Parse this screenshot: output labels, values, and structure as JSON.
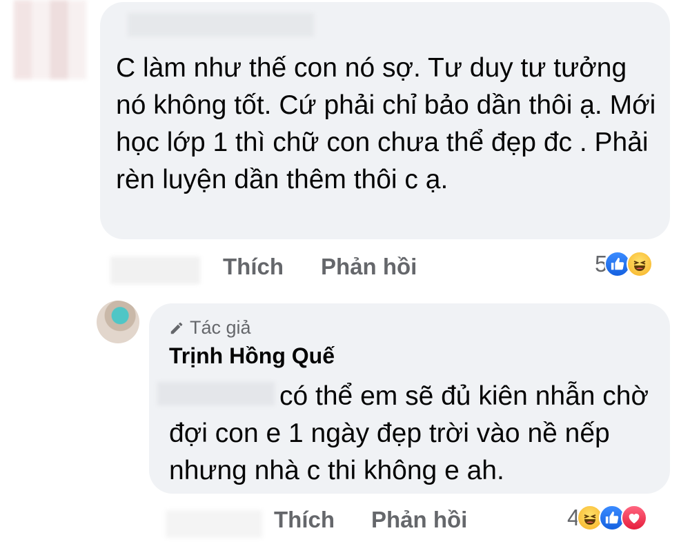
{
  "comment1": {
    "text": "C làm như thế con nó sợ. Tư duy tư tưởng nó không tốt. Cứ phải chỉ bảo dần thôi ạ. Mới học lớp 1 thì chữ con chưa thể đẹp đc . Phải rèn luyện dần thêm thôi c ạ.",
    "actions": {
      "like": "Thích",
      "reply": "Phản hồi"
    },
    "reaction_count": "5",
    "reactions": [
      "like-icon",
      "haha-icon"
    ]
  },
  "comment2": {
    "author_badge": "Tác giả",
    "author_name": "Trịnh Hồng Quế",
    "text": "có thể em sẽ đủ kiên nhẫn chờ đợi con e 1 ngày đẹp trời vào nề nếp nhưng nhà c thi không e ah.",
    "actions": {
      "like": "Thích",
      "reply": "Phản hồi"
    },
    "reaction_count": "4",
    "reactions": [
      "haha-icon",
      "like-icon",
      "love-icon"
    ]
  },
  "colors": {
    "bubble": "#f0f2f5",
    "secondary_text": "#65676b",
    "like_blue": "#1877f2",
    "haha_yellow": "#f7b125",
    "love_red": "#f33e58"
  }
}
